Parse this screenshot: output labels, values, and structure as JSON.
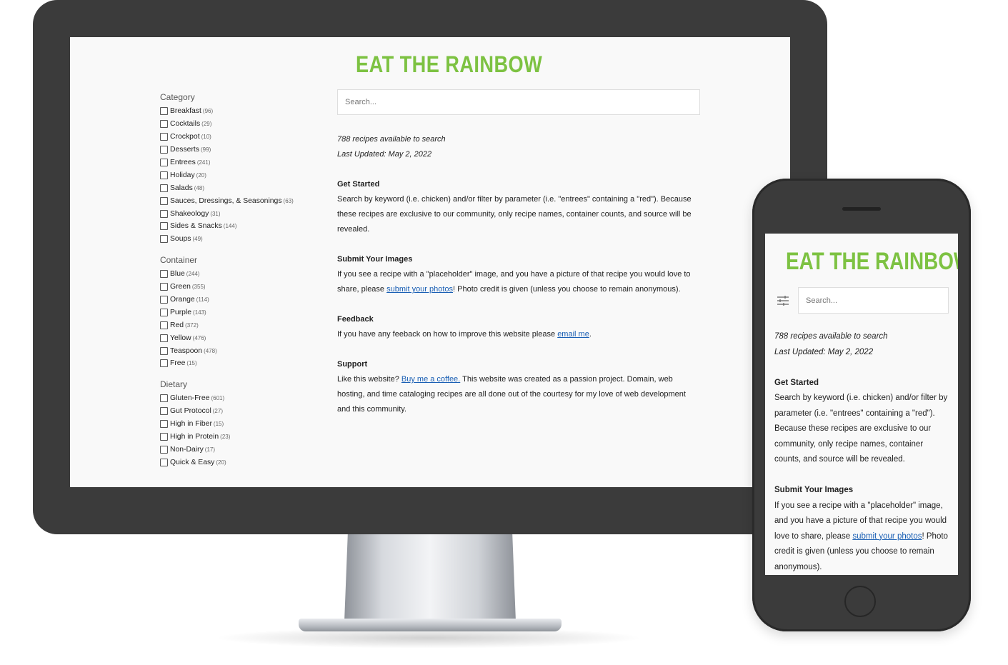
{
  "app": {
    "title": "EAT THE RAINBOW"
  },
  "search": {
    "placeholder": "Search..."
  },
  "filters": [
    {
      "title": "Category",
      "items": [
        {
          "label": "Breakfast",
          "count": "(96)"
        },
        {
          "label": "Cocktails",
          "count": "(29)"
        },
        {
          "label": "Crockpot",
          "count": "(10)"
        },
        {
          "label": "Desserts",
          "count": "(99)"
        },
        {
          "label": "Entrees",
          "count": "(241)"
        },
        {
          "label": "Holiday",
          "count": "(20)"
        },
        {
          "label": "Salads",
          "count": "(48)"
        },
        {
          "label": "Sauces, Dressings, & Seasonings",
          "count": "(63)"
        },
        {
          "label": "Shakeology",
          "count": "(31)"
        },
        {
          "label": "Sides & Snacks",
          "count": "(144)"
        },
        {
          "label": "Soups",
          "count": "(49)"
        }
      ]
    },
    {
      "title": "Container",
      "items": [
        {
          "label": "Blue",
          "count": "(244)"
        },
        {
          "label": "Green",
          "count": "(355)"
        },
        {
          "label": "Orange",
          "count": "(114)"
        },
        {
          "label": "Purple",
          "count": "(143)"
        },
        {
          "label": "Red",
          "count": "(372)"
        },
        {
          "label": "Yellow",
          "count": "(476)"
        },
        {
          "label": "Teaspoon",
          "count": "(478)"
        },
        {
          "label": "Free",
          "count": "(15)"
        }
      ]
    },
    {
      "title": "Dietary",
      "items": [
        {
          "label": "Gluten-Free",
          "count": "(601)"
        },
        {
          "label": "Gut Protocol",
          "count": "(27)"
        },
        {
          "label": "High in Fiber",
          "count": "(15)"
        },
        {
          "label": "High in Protein",
          "count": "(23)"
        },
        {
          "label": "Non-Dairy",
          "count": "(17)"
        },
        {
          "label": "Quick & Easy",
          "count": "(20)"
        }
      ]
    }
  ],
  "stats": {
    "available": "788 recipes available to search",
    "updated": "Last Updated: May 2, 2022"
  },
  "sections": {
    "get_started": {
      "heading": "Get Started",
      "text": "Search by keyword (i.e. chicken) and/or filter by parameter (i.e. \"entrees\" containing a \"red\"). Because these recipes are exclusive to our community, only recipe names, container counts, and source will be revealed."
    },
    "submit": {
      "heading": "Submit Your Images",
      "text_before": "If you see a recipe with a \"placeholder\" image, and you have a picture of that recipe you would love to share, please ",
      "link": "submit your photos",
      "text_after": "! Photo credit is given (unless you choose to remain anonymous)."
    },
    "feedback": {
      "heading": "Feedback",
      "text_before": "If you have any feeback on how to improve this website please ",
      "link": "email me",
      "text_after": "."
    },
    "support": {
      "heading": "Support",
      "text_before": "Like this website? ",
      "link": "Buy me a coffee.",
      "text_after": " This website was created as a passion project. Domain, web hosting, and time cataloging recipes are all done out of the courtesy for my love of web development and this community."
    }
  },
  "colors": {
    "brand_green": "#7dc242",
    "link_blue": "#1a5fb4",
    "device_dark": "#3b3b3b"
  },
  "icons": {
    "phone_filter": "sliders-icon"
  }
}
